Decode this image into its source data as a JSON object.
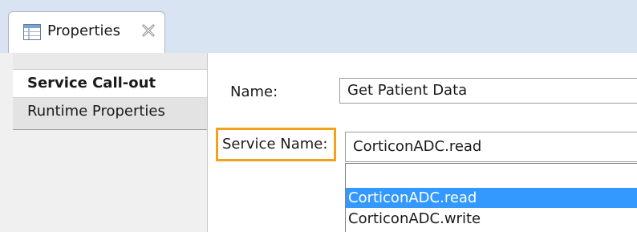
{
  "tab": {
    "icon": "properties-view-icon",
    "label": "Properties",
    "close_icon": "close-tab-icon"
  },
  "sections": {
    "items": [
      {
        "label": "Service Call-out",
        "selected": true
      },
      {
        "label": "Runtime Properties",
        "selected": false
      }
    ]
  },
  "form": {
    "name_label": "Name:",
    "name_value": "Get Patient Data",
    "service_label": "Service Name:",
    "service_value": "CorticonADC.read",
    "highlight_color": "#f5a21b"
  },
  "dropdown": {
    "options": [
      "",
      "CorticonADC.read",
      "CorticonADC.write"
    ],
    "selected": "CorticonADC.read",
    "selected_color": "#3399ff"
  }
}
